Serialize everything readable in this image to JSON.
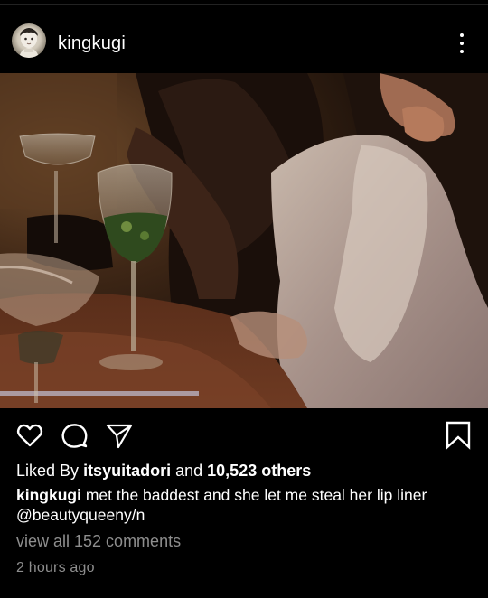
{
  "post": {
    "username": "kingkugi",
    "likes": {
      "prefix": "Liked By",
      "liker": "itsyuitadori",
      "conjunction": "and",
      "others": "10,523 others"
    },
    "caption": {
      "username": "kingkugi",
      "text": "met the baddest and she let me steal her lip liner",
      "mention": "@beautyqueeny/n"
    },
    "comments_link": "view all 152 comments",
    "timestamp": "2 hours ago"
  },
  "icons": {
    "more": "more-options-icon",
    "like": "heart-icon",
    "comment": "comment-bubble-icon",
    "share": "paper-plane-icon",
    "save": "bookmark-icon"
  },
  "colors": {
    "background": "#000000",
    "text": "#ffffff",
    "muted": "#8e8e8e"
  }
}
